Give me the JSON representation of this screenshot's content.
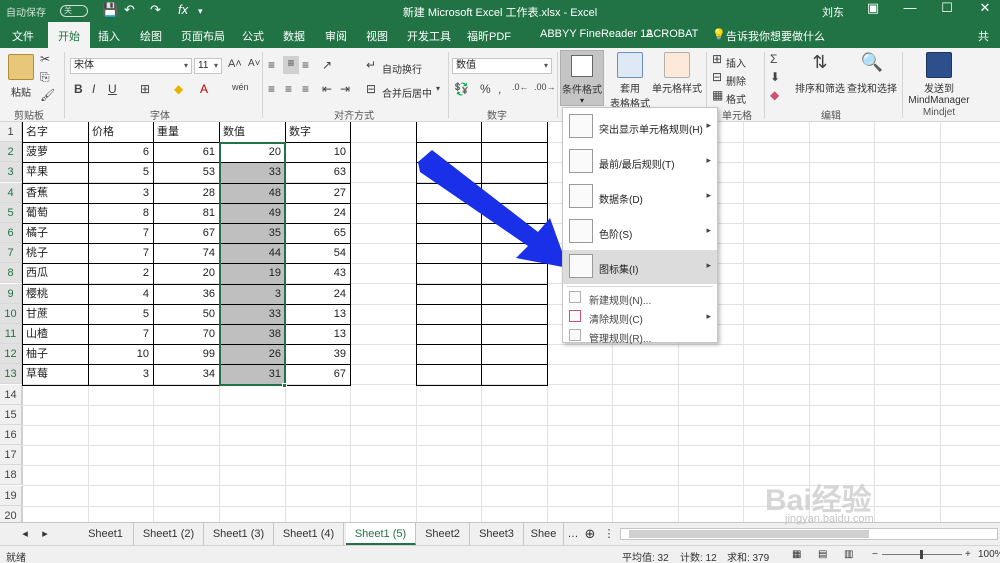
{
  "window": {
    "autosave_label": "自动保存",
    "autosave_state": "关",
    "title": "新建 Microsoft Excel 工作表.xlsx  -  Excel",
    "user": "刘东",
    "minimize": "—",
    "restore": "☐",
    "close": "✕"
  },
  "tabs": [
    "文件",
    "开始",
    "插入",
    "绘图",
    "页面布局",
    "公式",
    "数据",
    "审阅",
    "视图",
    "开发工具",
    "福昕PDF",
    "ABBYY FineReader 12",
    "ACROBAT"
  ],
  "tell_me": "告诉我你想要做什么",
  "share": "共",
  "ribbon": {
    "paste": "粘贴",
    "clipboard": "剪贴板",
    "font_name": "宋体",
    "font_size": "11",
    "font_group": "字体",
    "wrap_text": "自动换行",
    "merge_center": "合并后居中",
    "alignment_group": "对齐方式",
    "number_format": "数值",
    "number_group": "数字",
    "cond_format": "条件格式",
    "table_format_1": "套用",
    "table_format_2": "表格格式",
    "cell_style": "单元格样式",
    "insert": "插入",
    "delete": "删除",
    "format": "格式",
    "cells_group": "单元格",
    "sort_filter": "排序和筛选",
    "find_select": "查找和选择",
    "editing_group": "编辑",
    "send_to": "发送到",
    "mindmanager": "MindManager",
    "mindjet_group": "Mindjet"
  },
  "colors": {
    "excel_green": "#217346",
    "highlight_gray": "#bfbfbf",
    "arrow_blue": "#1a2fe8"
  },
  "sheet": {
    "headers": [
      "名字",
      "价格",
      "重量",
      "数值",
      "数字"
    ],
    "rows": [
      [
        "菠萝",
        "6",
        "61",
        "20",
        "10"
      ],
      [
        "苹果",
        "5",
        "53",
        "33",
        "63"
      ],
      [
        "香蕉",
        "3",
        "28",
        "48",
        "27"
      ],
      [
        "葡萄",
        "8",
        "81",
        "49",
        "24"
      ],
      [
        "橘子",
        "7",
        "67",
        "35",
        "65"
      ],
      [
        "桃子",
        "7",
        "74",
        "44",
        "54"
      ],
      [
        "西瓜",
        "2",
        "20",
        "19",
        "43"
      ],
      [
        "樱桃",
        "4",
        "36",
        "3",
        "24"
      ],
      [
        "甘蔗",
        "5",
        "50",
        "33",
        "13"
      ],
      [
        "山楂",
        "7",
        "70",
        "38",
        "13"
      ],
      [
        "柚子",
        "10",
        "99",
        "26",
        "39"
      ],
      [
        "草莓",
        "3",
        "34",
        "31",
        "67"
      ]
    ],
    "row_numbers": [
      "1",
      "2",
      "3",
      "4",
      "5",
      "6",
      "7",
      "8",
      "9",
      "10",
      "11",
      "12",
      "13",
      "14",
      "15",
      "16",
      "17",
      "18",
      "19",
      "20"
    ]
  },
  "cf_menu": {
    "items": [
      {
        "label": "突出显示单元格规则(H)",
        "icon": "highlight-cells-icon"
      },
      {
        "label": "最前/最后规则(T)",
        "icon": "top-bottom-icon"
      },
      {
        "label": "数据条(D)",
        "icon": "data-bars-icon"
      },
      {
        "label": "色阶(S)",
        "icon": "color-scales-icon"
      },
      {
        "label": "图标集(I)",
        "icon": "icon-sets-icon"
      }
    ],
    "small_items": [
      {
        "label": "新建规则(N)...",
        "icon": "new-rule-icon"
      },
      {
        "label": "清除规则(C)",
        "icon": "clear-rules-icon"
      },
      {
        "label": "管理规则(R)...",
        "icon": "manage-rules-icon"
      }
    ]
  },
  "sheet_tabs": [
    "Sheet1",
    "Sheet1 (2)",
    "Sheet1 (3)",
    "Sheet1 (4)",
    "Sheet1 (5)",
    "Sheet2",
    "Sheet3",
    "Shee"
  ],
  "active_sheet": "Sheet1 (5)",
  "status": {
    "mode": "就绪",
    "average": "平均值: 32",
    "count": "计数: 12",
    "sum": "求和: 379",
    "zoom": "100%"
  },
  "watermark": {
    "text": "Bai经验",
    "url": "jingyan.baidu.com"
  }
}
